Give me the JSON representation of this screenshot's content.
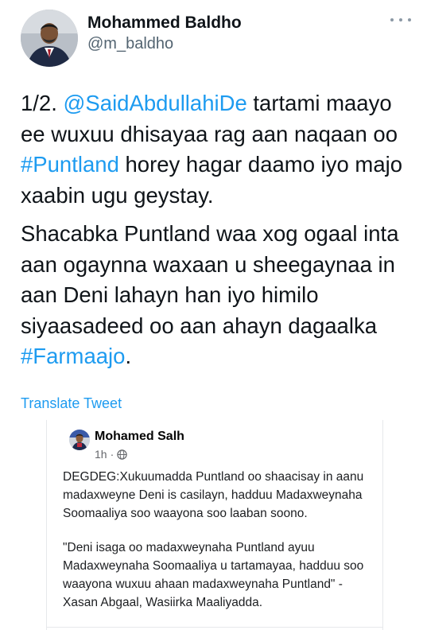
{
  "author": {
    "name": "Mohammed Baldho",
    "handle": "@m_baldho"
  },
  "tweet": {
    "p1_prefix": "1/2. ",
    "p1_mention": "@SaidAbdullahiDe",
    "p1_mid": " tartami maayo ee wuxuu dhisayaa rag aan naqaan oo ",
    "p1_hashtag": "#Puntland",
    "p1_suffix": " horey hagar daamo iyo majo xaabin ugu geystay.",
    "p2_prefix": "Shacabka Puntland waa xog ogaal inta aan ogaynna waxaan u sheegaynaa in aan Deni lahayn han iyo himilo siyaasadeed oo aan ahayn dagaalka ",
    "p2_hashtag": "#Farmaajo",
    "p2_suffix": "."
  },
  "translate_label": "Translate Tweet",
  "fb_post": {
    "author": "Mohamed Salh",
    "time": "1h",
    "separator": "·",
    "text1": "DEGDEG:Xukuumadda Puntland oo shaacisay in aanu madaxweyne Deni is casilayn, hadduu Madaxweynaha Soomaaliya soo waayona soo laaban soono.",
    "text2": "\"Deni isaga oo madaxweynaha Puntland ayuu Madaxweynaha Soomaaliya u tartamayaa, hadduu soo waayona wuxuu ahaan madaxweynaha Puntland\" - Xasan Abgaal, Wasiirka Maaliyadda."
  },
  "colors": {
    "link": "#1d9bf0",
    "text": "#0f1419",
    "secondary": "#536471"
  },
  "icons": {
    "more": "more-dots-icon",
    "globe": "globe-icon"
  }
}
